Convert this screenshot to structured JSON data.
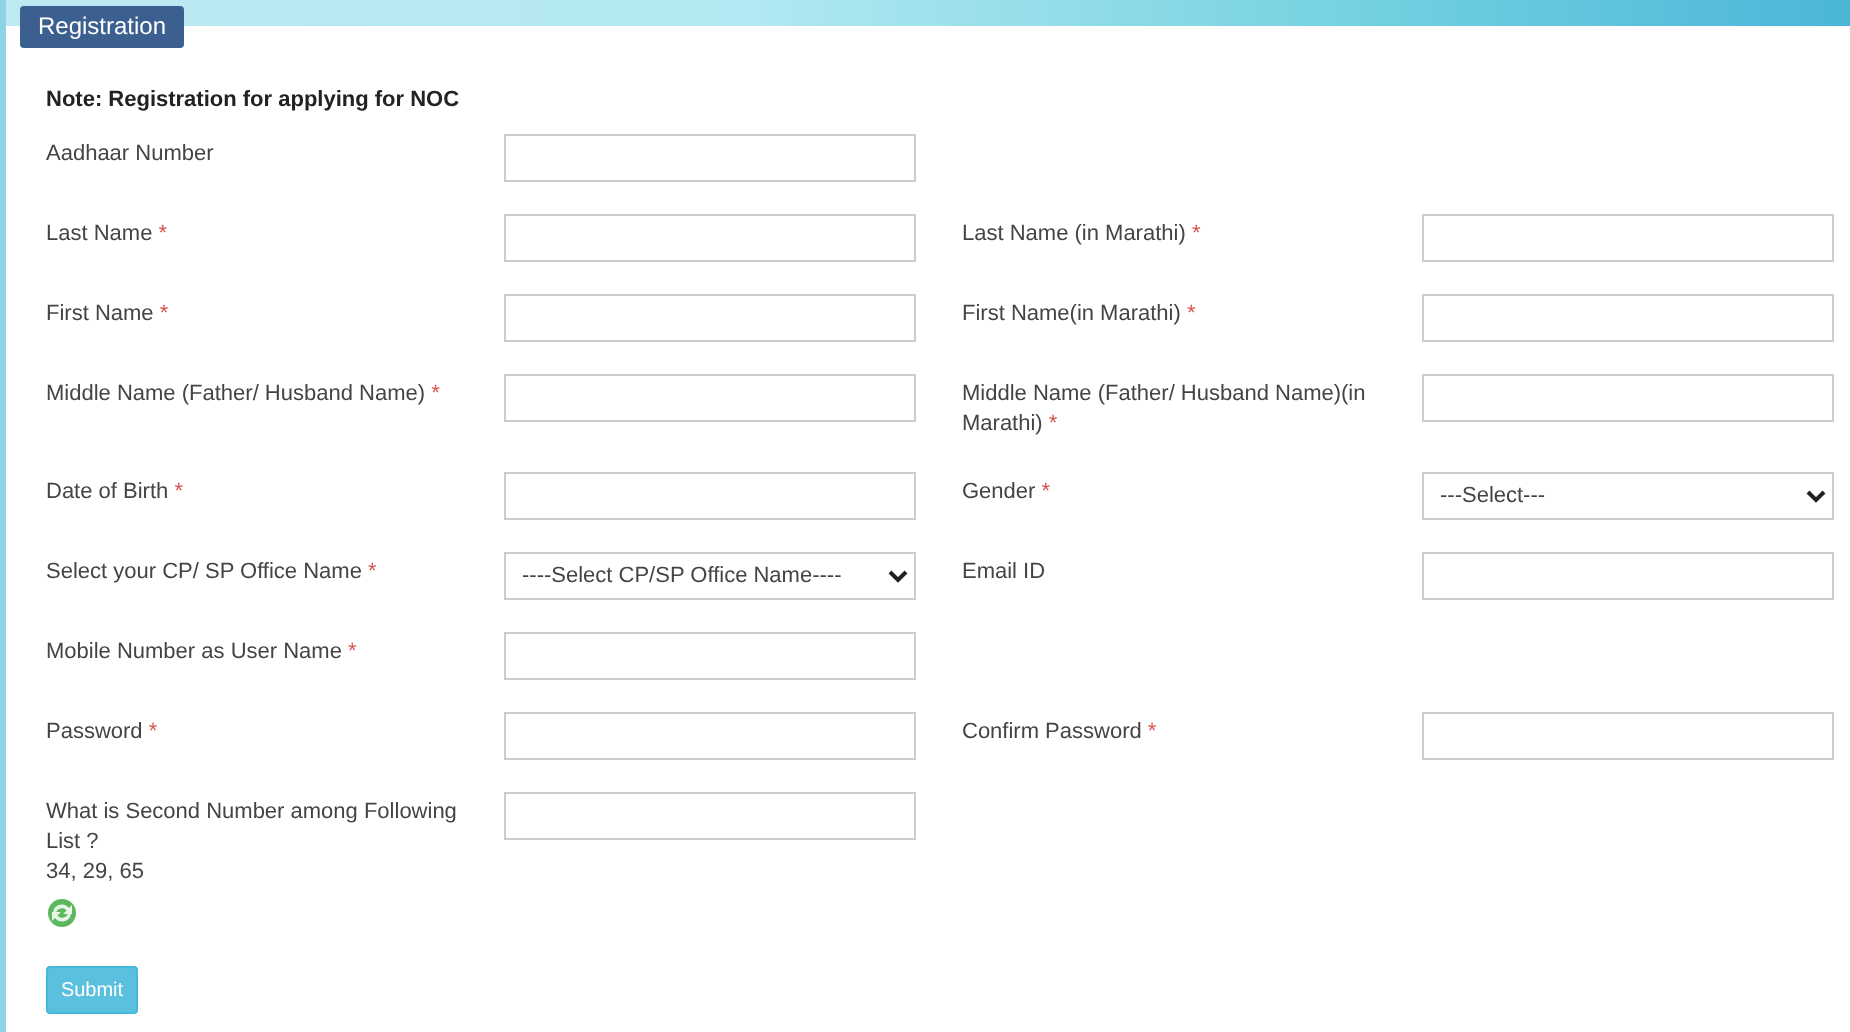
{
  "heading": "Registration",
  "note": "Note: Registration for applying for NOC",
  "rows": [
    {
      "left": {
        "label": "Aadhaar Number",
        "kind": "text"
      }
    },
    {
      "left": {
        "label": "Last Name",
        "required_mark": "*",
        "kind": "text"
      },
      "right": {
        "label": "Last Name (in Marathi)",
        "required_mark": "*",
        "kind": "text"
      }
    },
    {
      "left": {
        "label": "First Name",
        "required_mark": "*",
        "kind": "text"
      },
      "right": {
        "label": "First Name(in Marathi)",
        "required_mark": "*",
        "kind": "text"
      }
    },
    {
      "left": {
        "label": "Middle Name (Father/ Husband Name)",
        "required_mark": "*",
        "kind": "text"
      },
      "right": {
        "label": "Middle Name (Father/ Husband Name)(in Marathi)",
        "required_mark": "*",
        "kind": "text"
      }
    },
    {
      "left": {
        "label": "Date of Birth",
        "required_mark": "*",
        "kind": "text"
      },
      "right": {
        "label": "Gender",
        "required_mark": "*",
        "kind": "select",
        "value": "---Select---"
      }
    },
    {
      "left": {
        "label": "Select your CP/ SP Office Name",
        "required_mark": "*",
        "kind": "select",
        "value": "----Select CP/SP Office Name----"
      },
      "right": {
        "label": "Email ID",
        "kind": "text"
      }
    },
    {
      "left": {
        "label": "Mobile Number as User Name",
        "required_mark": "*",
        "kind": "text"
      }
    },
    {
      "left": {
        "label": "Password",
        "required_mark": "*",
        "kind": "text"
      },
      "right": {
        "label": "Confirm Password",
        "required_mark": "*",
        "kind": "text"
      }
    }
  ],
  "captcha": {
    "question": "What is Second Number among Following List ?",
    "numbers": "34, 29, 65"
  },
  "submit": "Submit"
}
